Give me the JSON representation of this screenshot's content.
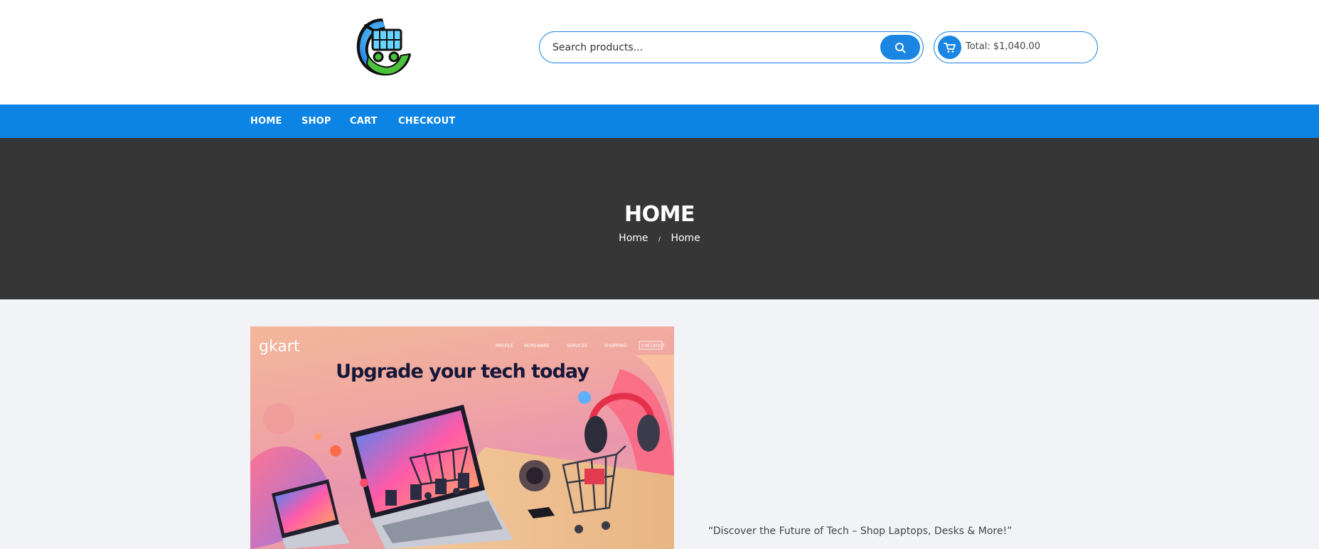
{
  "header": {
    "logo_icon": "shopping-cart-logo-icon",
    "search": {
      "placeholder": "Search products...",
      "value": ""
    },
    "cart": {
      "total_text": "Total: $1,040.00"
    }
  },
  "nav": {
    "items": [
      {
        "label": "HOME"
      },
      {
        "label": "SHOP"
      },
      {
        "label": "CART"
      },
      {
        "label": "CHECKOUT"
      }
    ]
  },
  "hero": {
    "title": "HOME",
    "breadcrumb": [
      "Home",
      "Home"
    ],
    "separator": "/"
  },
  "banner": {
    "brand": "gkart",
    "headline": "Upgrade your tech today",
    "menu_items": [
      "PROFILE",
      "MOREWARE",
      "SERVICES",
      "SHOPPING",
      "CHECKOUT"
    ]
  },
  "main": {
    "tagline": "“Discover the Future of Tech – Shop Laptops, Desks & More!”"
  },
  "colors": {
    "accent": "#0b84e6",
    "hero_bg": "#363636",
    "content_bg": "#f2f3f7"
  }
}
